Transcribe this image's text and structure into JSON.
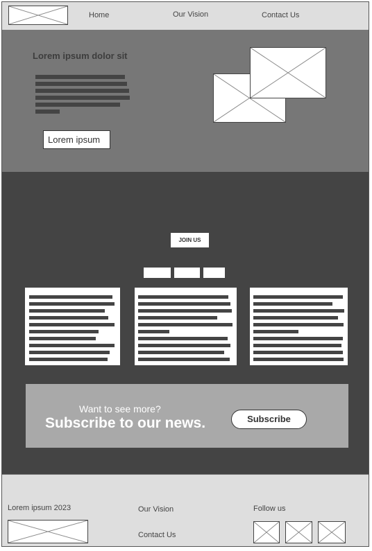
{
  "nav": {
    "links": [
      "Home",
      "Our Vision",
      "Contact Us"
    ]
  },
  "hero": {
    "title": "Lorem ipsum dolor sit",
    "button_label": "Lorem ipsum"
  },
  "content": {
    "join_label": "JOIN US"
  },
  "subscribe": {
    "small_text": "Want to see more?",
    "big_text": "Subscribe to our news.",
    "button_label": "Subscribe"
  },
  "footer": {
    "copyright": "Lorem ipsum 2023",
    "links": [
      "Our Vision",
      "Contact Us"
    ],
    "follow_label": "Follow us"
  }
}
